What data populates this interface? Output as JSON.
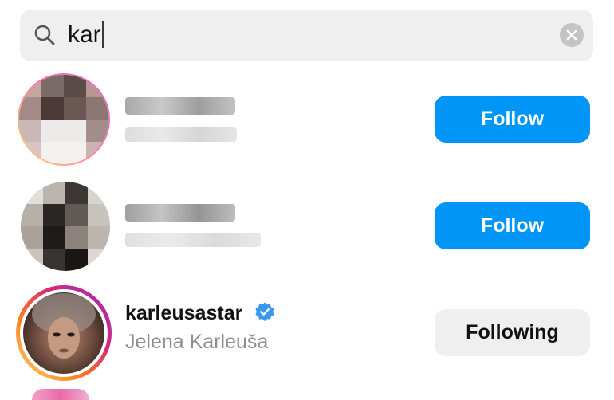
{
  "search": {
    "query": "kar",
    "icon": "search-icon",
    "clear_icon": "clear-icon"
  },
  "results": [
    {
      "username": "",
      "full_name": "",
      "button_label": "Follow",
      "button_style": "follow",
      "avatar_icon": "pixelated-avatar",
      "has_story_ring": true
    },
    {
      "username": "",
      "full_name": "",
      "button_label": "Follow",
      "button_style": "follow",
      "avatar_icon": "pixelated-avatar",
      "has_story_ring": false
    },
    {
      "username": "karleusastar",
      "full_name": "Jelena Karleuša",
      "verified": true,
      "button_label": "Following",
      "button_style": "following",
      "avatar_icon": "profile-avatar",
      "has_story_ring": true
    }
  ],
  "colors": {
    "follow_button": "#0095f6",
    "following_button": "#efefef",
    "verified_badge": "#3897f0",
    "search_bar": "#efefef"
  }
}
